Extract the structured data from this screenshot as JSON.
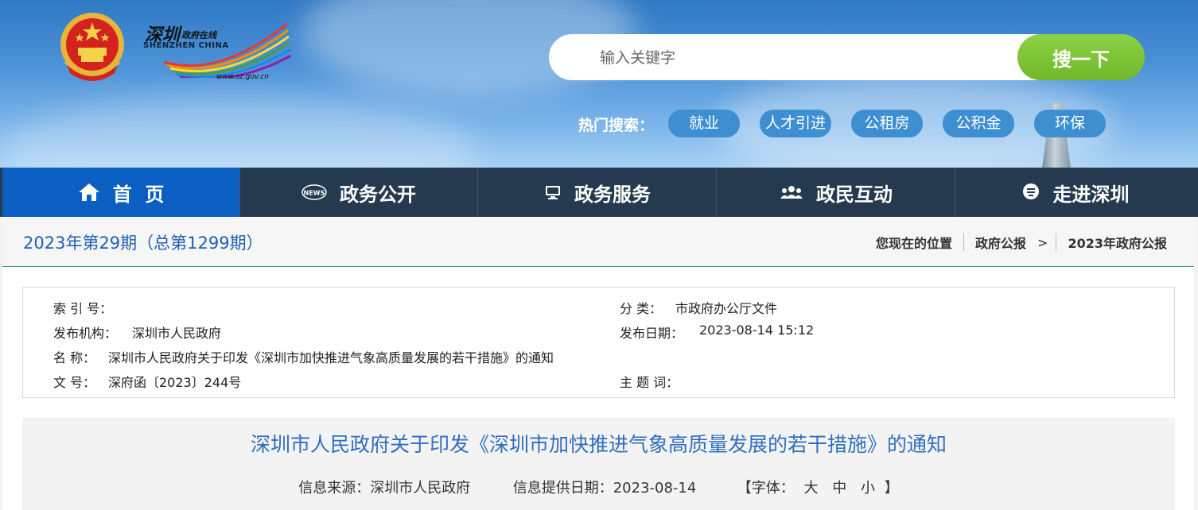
{
  "header": {
    "logo": {
      "cn": "深圳",
      "cn_sub": "政府在线",
      "en": "SHENZHEN  CHINA",
      "url": "www.sz.gov.cn"
    },
    "search": {
      "placeholder": "输入关键字",
      "button_label": "搜一下"
    },
    "hot_search": {
      "label": "热门搜索：",
      "tags": [
        "就业",
        "人才引进",
        "公租房",
        "公积金",
        "环保"
      ]
    }
  },
  "nav": {
    "items": [
      {
        "label": "首  页",
        "icon": "home-icon"
      },
      {
        "label": "政务公开",
        "icon": "news-icon"
      },
      {
        "label": "政务服务",
        "icon": "monitor-icon"
      },
      {
        "label": "政民互动",
        "icon": "users-icon"
      },
      {
        "label": "走进深圳",
        "icon": "speech-icon"
      }
    ],
    "active": 0
  },
  "breadcrumb_bar": {
    "issue_title": "2023年第29期（总第1299期）",
    "location_label": "您现在的位置",
    "crumbs": [
      "政府公报",
      "2023年政府公报"
    ]
  },
  "meta": {
    "index_no": {
      "label": "索 引 号：",
      "value": ""
    },
    "category": {
      "label": "分 类：",
      "value": "市政府办公厅文件"
    },
    "publisher": {
      "label": "发布机构：",
      "value": "深圳市人民政府"
    },
    "publish_date": {
      "label": "发布日期：",
      "value": "2023-08-14 15:12"
    },
    "name": {
      "label": "名 称：",
      "value": "深圳市人民政府关于印发《深圳市加快推进气象高质量发展的若干措施》的通知"
    },
    "doc_no": {
      "label": "文 号：",
      "value": "深府函〔2023〕244号"
    },
    "keywords": {
      "label": "主 题 词：",
      "value": ""
    }
  },
  "article": {
    "title": "深圳市人民政府关于印发《深圳市加快推进气象高质量发展的若干措施》的通知",
    "source": "信息来源：深圳市人民政府",
    "provide_date": "信息提供日期：2023-08-14",
    "font_label_open": "【字体：",
    "font_sizes": [
      "大",
      "中",
      "小"
    ],
    "font_label_close": "】"
  },
  "colors": {
    "nav_bg": "#263a4f",
    "nav_active": "#0c5fc2",
    "search_button": "#7dc33a",
    "title_blue": "#2f6fc0"
  }
}
